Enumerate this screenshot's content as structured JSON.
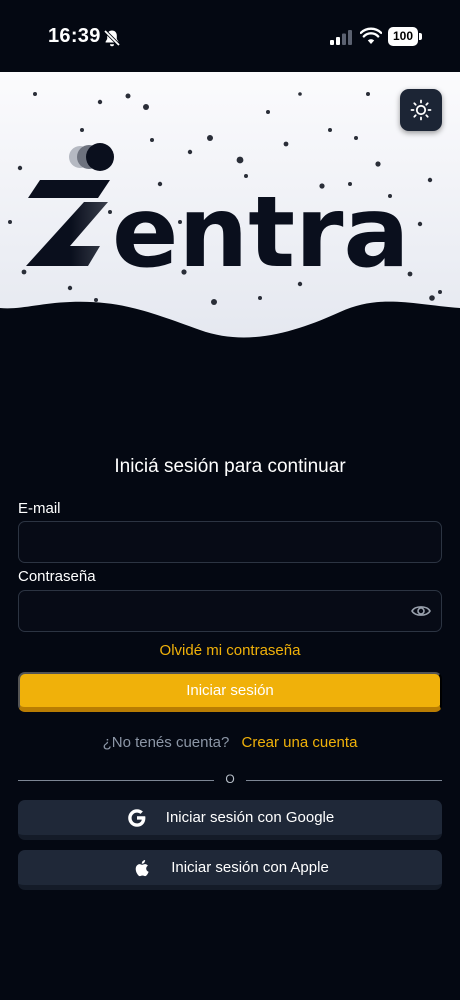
{
  "status_bar": {
    "time": "16:39",
    "battery": "100",
    "icons": [
      "bell-slash-icon",
      "signal-icon",
      "wifi-icon",
      "battery-icon"
    ]
  },
  "hero": {
    "brand_name": "Zentra",
    "theme_toggle_icon": "sun-icon",
    "colors": {
      "hero_bg": "#ffffff",
      "logo": "#0a0f1d",
      "page_bg": "#040812"
    }
  },
  "login": {
    "title": "Iniciá sesión para continuar",
    "email_label": "E-mail",
    "email_value": "",
    "email_placeholder": "",
    "password_label": "Contraseña",
    "password_value": "",
    "password_placeholder": "",
    "password_toggle_icon": "eye-icon",
    "forgot_password": "Olvidé mi contraseña",
    "submit_label": "Iniciar sesión",
    "signup_prompt": "¿No tenés cuenta?",
    "signup_link": "Crear una cuenta",
    "divider_text": "O",
    "google_button": "Iniciar sesión con Google",
    "google_icon": "google-icon",
    "apple_button": "Iniciar sesión con Apple",
    "apple_icon": "apple-icon"
  },
  "colors": {
    "accent": "#f0b10a",
    "input_border": "#2c3442",
    "social_button_bg": "#1f2838",
    "muted_text": "#8c96a6"
  }
}
